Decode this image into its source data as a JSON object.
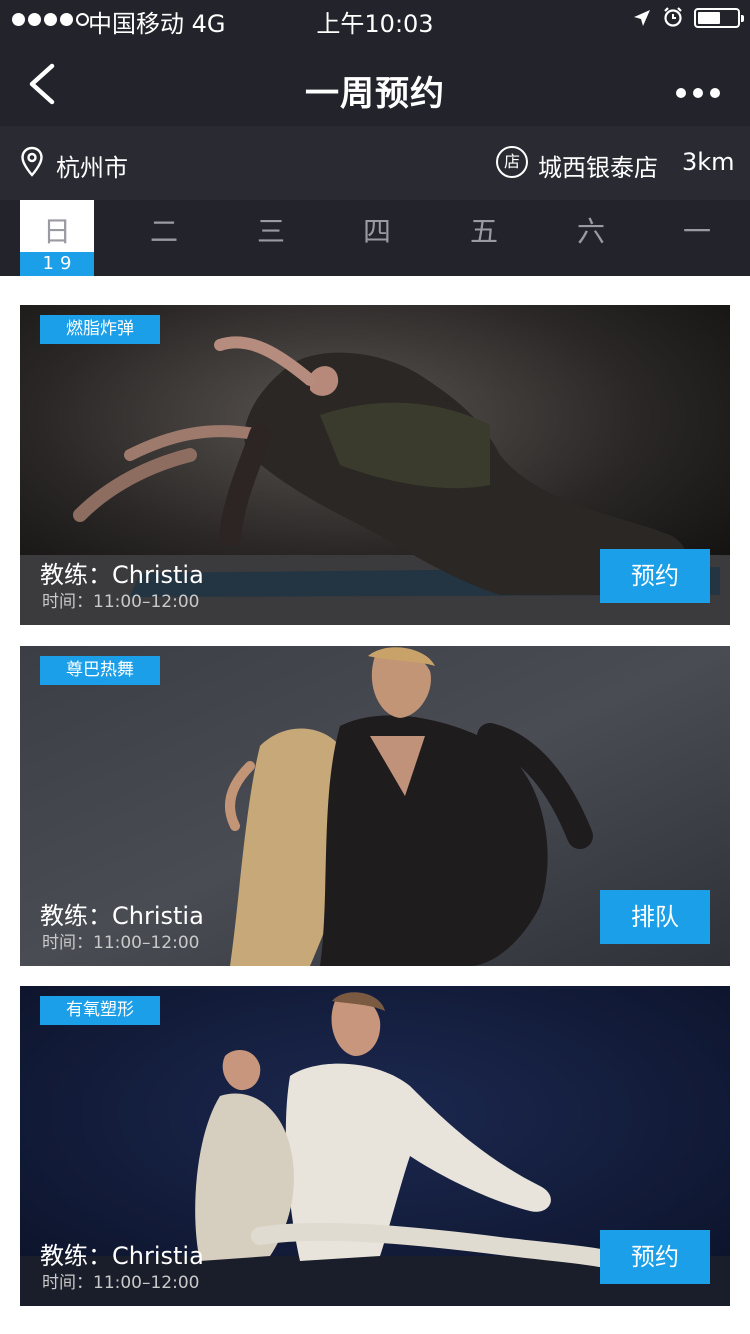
{
  "status_bar": {
    "carrier": "中国移动  4G",
    "time": "上午10:03"
  },
  "nav": {
    "title": "一周预约"
  },
  "location": {
    "city": "杭州市",
    "store_badge": "店",
    "store": "城西银泰店",
    "distance": "3km"
  },
  "days": [
    {
      "label": "日",
      "date": "19",
      "active": true
    },
    {
      "label": "二"
    },
    {
      "label": "三"
    },
    {
      "label": "四"
    },
    {
      "label": "五"
    },
    {
      "label": "六"
    },
    {
      "label": "一"
    }
  ],
  "classes": [
    {
      "tag": "燃脂炸弹",
      "coach": "教练：Christia",
      "time": "时间：11:00–12:00",
      "button": "预约"
    },
    {
      "tag": "尊巴热舞",
      "coach": "教练：Christia",
      "time": "时间：11:00–12:00",
      "button": "排队"
    },
    {
      "tag": "有氧塑形",
      "coach": "教练：Christia",
      "time": "时间：11:00–12:00",
      "button": "预约"
    }
  ],
  "colors": {
    "header_bg": "#23232b",
    "accent": "#1b9fe8"
  }
}
